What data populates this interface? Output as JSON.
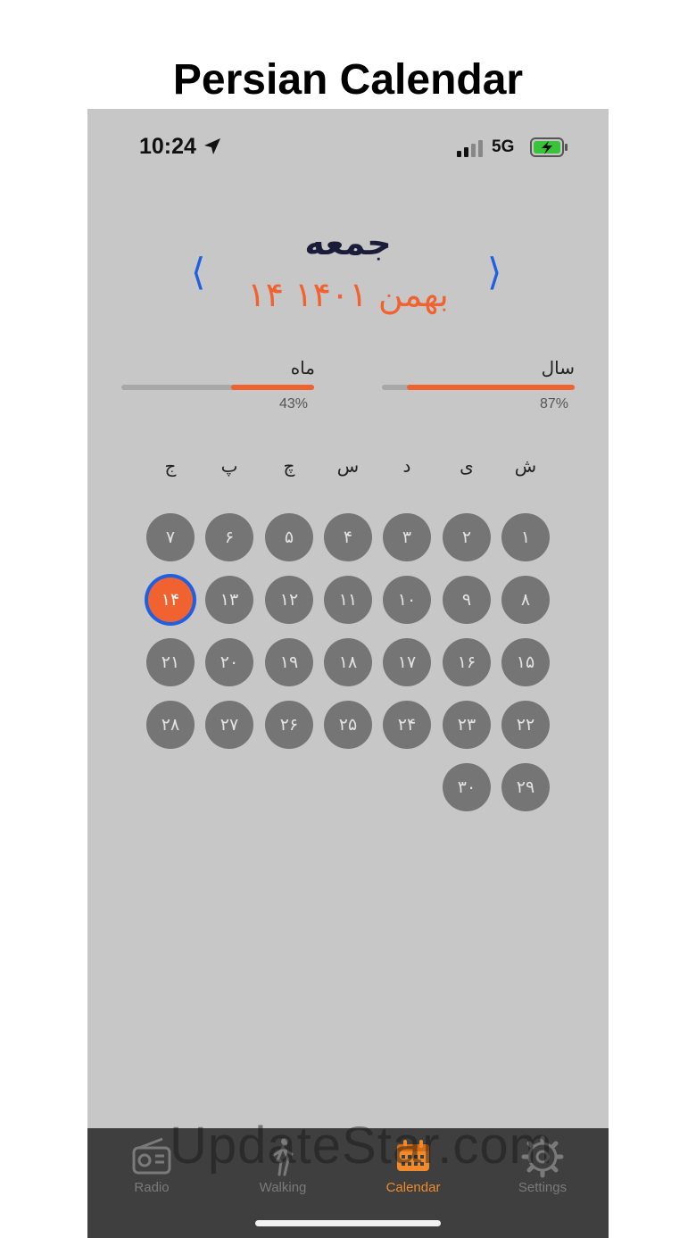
{
  "page_title": "Persian Calendar",
  "status_bar": {
    "time": "10:24",
    "network": "5G"
  },
  "header": {
    "day_name": "جمعه",
    "full_date": "۱۴ بهمن ۱۴۰۱"
  },
  "progress": {
    "month": {
      "label": "ماه",
      "percent_text": "43%",
      "fraction": 0.43
    },
    "year": {
      "label": "سال",
      "percent_text": "87%",
      "fraction": 0.87
    }
  },
  "weekdays": [
    "ش",
    "ی",
    "د",
    "س",
    "چ",
    "پ",
    "ج"
  ],
  "days": [
    "۱",
    "۲",
    "۳",
    "۴",
    "۵",
    "۶",
    "۷",
    "۸",
    "۹",
    "۱۰",
    "۱۱",
    "۱۲",
    "۱۳",
    "۱۴",
    "۱۵",
    "۱۶",
    "۱۷",
    "۱۸",
    "۱۹",
    "۲۰",
    "۲۱",
    "۲۲",
    "۲۳",
    "۲۴",
    "۲۵",
    "۲۶",
    "۲۷",
    "۲۸",
    "۲۹",
    "۳۰"
  ],
  "today_index": 13,
  "tabs": [
    {
      "label": "Radio",
      "icon": "radio-icon",
      "active": false
    },
    {
      "label": "Walking",
      "icon": "walking-icon",
      "active": false
    },
    {
      "label": "Calendar",
      "icon": "calendar-icon",
      "active": true
    },
    {
      "label": "Settings",
      "icon": "gear-icon",
      "active": false
    }
  ],
  "watermark": "UpdateStar.com",
  "colors": {
    "accent": "#f06230",
    "today_ring": "#1f5fe0",
    "tab_active": "#f08a2a",
    "day_cell": "#757575"
  }
}
